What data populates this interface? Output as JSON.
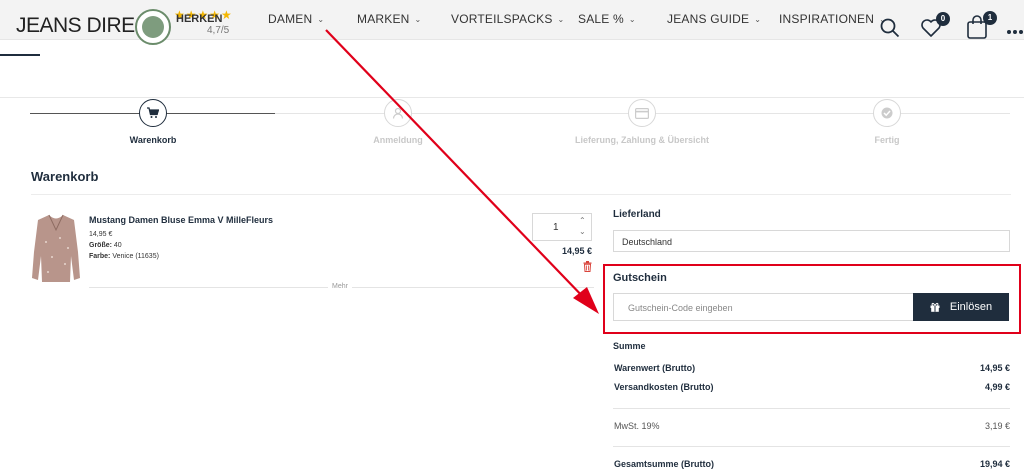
{
  "header": {
    "logo": "JEANS DIRECT",
    "rating_label": "HERKEN",
    "rating": "4,7/5",
    "nav": [
      {
        "label": "DAMEN"
      },
      {
        "label": "MARKEN"
      },
      {
        "label": "VORTEILSPACKS"
      },
      {
        "label": "SALE %"
      },
      {
        "label": "JEANS GUIDE"
      },
      {
        "label": "INSPIRATIONEN"
      }
    ],
    "wishlist_count": "0",
    "cart_count": "1"
  },
  "steps": [
    {
      "label": "Warenkorb",
      "icon": "cart-icon",
      "active": true
    },
    {
      "label": "Anmeldung",
      "icon": "user-icon",
      "active": false
    },
    {
      "label": "Lieferung, Zahlung & Übersicht",
      "icon": "credit-card-icon",
      "active": false
    },
    {
      "label": "Fertig",
      "icon": "check-icon",
      "active": false
    }
  ],
  "cart": {
    "title": "Warenkorb",
    "item": {
      "name": "Mustang Damen Bluse Emma V MilleFleurs",
      "unit_price": "14,95 €",
      "size_label": "Größe:",
      "size": "40",
      "color_label": "Farbe:",
      "color": "Venice (11635)",
      "quantity": "1",
      "total": "14,95 €"
    },
    "more": "Mehr"
  },
  "checkout": {
    "country_label": "Lieferland",
    "country": "Deutschland",
    "voucher_label": "Gutschein",
    "voucher_placeholder": "Gutschein-Code eingeben",
    "voucher_button": "Einlösen",
    "sum_label": "Summe",
    "rows": [
      {
        "label": "Warenwert (Brutto)",
        "value": "14,95 €"
      },
      {
        "label": "Versandkosten (Brutto)",
        "value": "4,99 €"
      },
      {
        "label": "MwSt. 19%",
        "value": "3,19 €"
      },
      {
        "label": "Gesamtsumme (Brutto)",
        "value": "19,94 €"
      }
    ]
  },
  "colors": {
    "primary": "#1f2d3d",
    "highlight": "#e0001a",
    "stars": "#f5b700"
  }
}
